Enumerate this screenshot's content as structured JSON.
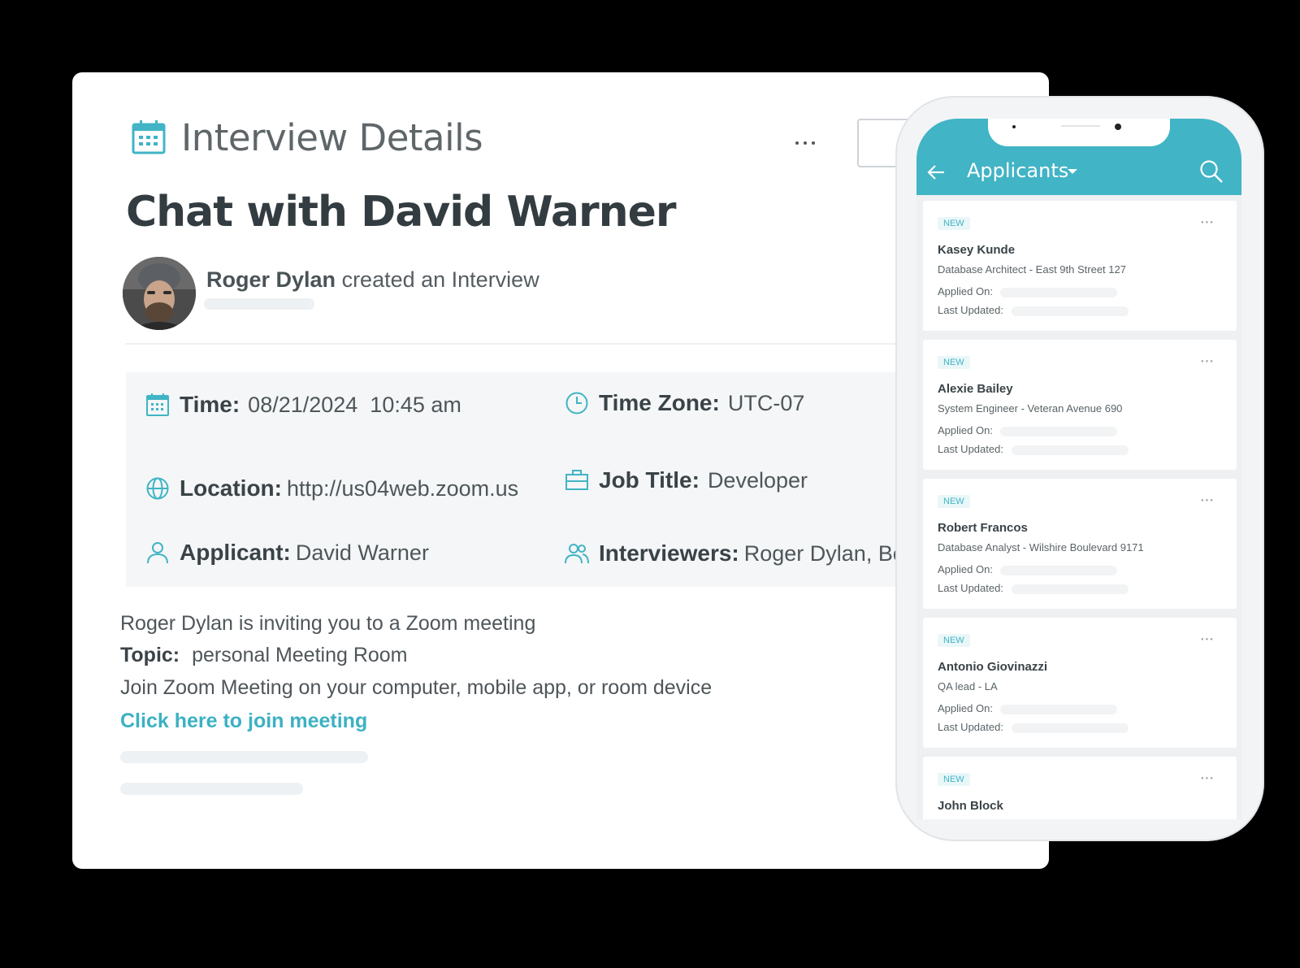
{
  "interview": {
    "header_title": "Interview Details",
    "title": "Chat with David Warner",
    "creator_name": "Roger Dylan",
    "creator_action": "created an Interview",
    "fields": {
      "time_label": "Time:",
      "time_value": "08/21/2024  10:45 am",
      "timezone_label": "Time Zone:",
      "timezone_value": "UTC-07",
      "location_label": "Location:",
      "location_value": "http://us04web.zoom.us",
      "jobtitle_label": "Job Title:",
      "jobtitle_value": "Developer",
      "applicant_label": "Applicant:",
      "applicant_value": "David Warner",
      "interviewers_label": "Interviewers:",
      "interviewers_value": "Roger Dylan, Bo"
    },
    "invite_line": "Roger Dylan is inviting you to a Zoom meeting",
    "topic_label": "Topic:",
    "topic_value": "personal Meeting Room",
    "join_line": "Join Zoom Meeting on your computer, mobile app, or room device",
    "join_link": "Click here to join meeting"
  },
  "mobile": {
    "title": "Applicants",
    "applied_label": "Applied On:",
    "updated_label": "Last Updated:",
    "applicants": [
      {
        "badge": "NEW",
        "name": "Kasey Kunde",
        "role": "Database Architect - East 9th Street 127"
      },
      {
        "badge": "NEW",
        "name": "Alexie Bailey",
        "role": "System Engineer - Veteran Avenue 690"
      },
      {
        "badge": "NEW",
        "name": "Robert Francos",
        "role": "Database Analyst - Wilshire Boulevard 9171"
      },
      {
        "badge": "NEW",
        "name": "Antonio Giovinazzi",
        "role": "QA lead - LA"
      },
      {
        "badge": "NEW",
        "name": "John Block",
        "role": ""
      }
    ]
  },
  "colors": {
    "accent": "#41b4c5",
    "link": "#3cb1c3",
    "panel": "#f4f6f7"
  }
}
